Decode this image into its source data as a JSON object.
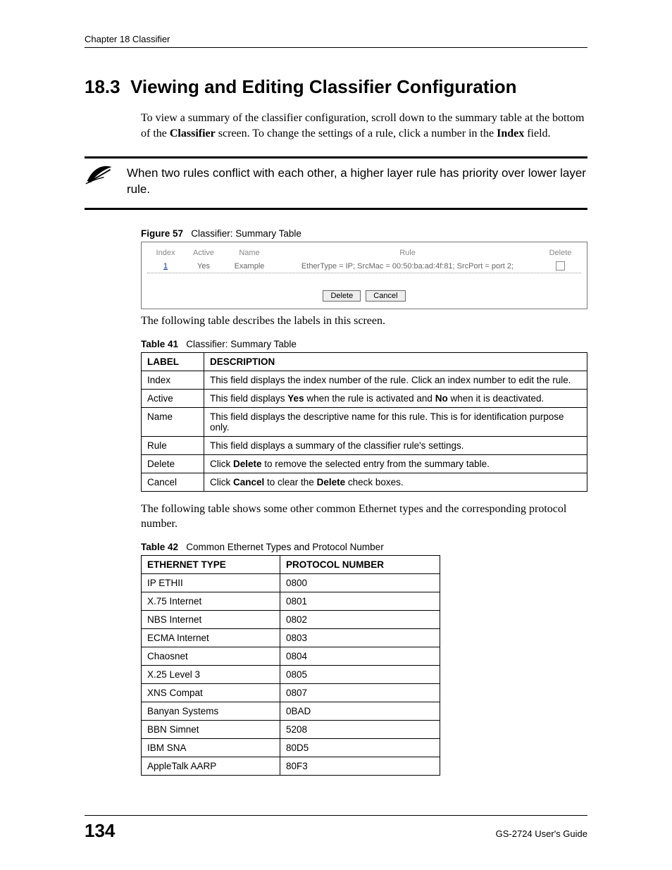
{
  "header": {
    "running": "Chapter 18 Classifier"
  },
  "section": {
    "number": "18.3",
    "title": "Viewing and Editing Classifier Configuration",
    "intro_part1": "To view a summary of the classifier configuration, scroll down to the summary table at the bottom of the ",
    "intro_bold1": "Classifier",
    "intro_part2": " screen. To change the settings of a rule, click a number in the ",
    "intro_bold2": "Index",
    "intro_part3": " field."
  },
  "note": {
    "text": "When two rules conflict with each other, a higher layer rule has priority over lower layer rule."
  },
  "figure57": {
    "label": "Figure 57",
    "title": "Classifier: Summary Table",
    "columns": {
      "index": "Index",
      "active": "Active",
      "name": "Name",
      "rule": "Rule",
      "delete": "Delete"
    },
    "row": {
      "index": "1",
      "active": "Yes",
      "name": "Example",
      "rule": "EtherType = IP; SrcMac = 00:50:ba:ad:4f:81; SrcPort = port 2;"
    },
    "buttons": {
      "delete": "Delete",
      "cancel": "Cancel"
    }
  },
  "after_fig_text": "The following table describes the labels in this screen.",
  "table41": {
    "label": "Table 41",
    "title": "Classifier: Summary Table",
    "headers": {
      "label": "LABEL",
      "description": "DESCRIPTION"
    },
    "rows": [
      {
        "label": "Index",
        "desc_pre": "This field displays the index number of the rule. Click an index number to edit the rule.",
        "b1": "",
        "mid": "",
        "b2": "",
        "post": ""
      },
      {
        "label": "Active",
        "desc_pre": "This field displays ",
        "b1": "Yes",
        "mid": " when the rule is activated and ",
        "b2": "No",
        "post": " when it is deactivated."
      },
      {
        "label": "Name",
        "desc_pre": "This field displays the descriptive name for this rule. This is for identification purpose only.",
        "b1": "",
        "mid": "",
        "b2": "",
        "post": ""
      },
      {
        "label": "Rule",
        "desc_pre": "This field displays a summary of the classifier rule's settings.",
        "b1": "",
        "mid": "",
        "b2": "",
        "post": ""
      },
      {
        "label": "Delete",
        "desc_pre": "Click ",
        "b1": "Delete",
        "mid": " to remove the selected entry from the summary table.",
        "b2": "",
        "post": ""
      },
      {
        "label": "Cancel",
        "desc_pre": "Click ",
        "b1": "Cancel",
        "mid": " to clear the ",
        "b2": "Delete",
        "post": " check boxes."
      }
    ]
  },
  "between_tables_text": "The following table shows some other common Ethernet types and the corresponding protocol number.",
  "table42": {
    "label": "Table 42",
    "title": "Common Ethernet Types and Protocol Number",
    "headers": {
      "type": "ETHERNET TYPE",
      "proto": "PROTOCOL NUMBER"
    },
    "rows": [
      {
        "type": "IP ETHII",
        "proto": "0800"
      },
      {
        "type": "X.75 Internet",
        "proto": "0801"
      },
      {
        "type": "NBS Internet",
        "proto": "0802"
      },
      {
        "type": "ECMA Internet",
        "proto": "0803"
      },
      {
        "type": "Chaosnet",
        "proto": "0804"
      },
      {
        "type": "X.25 Level 3",
        "proto": "0805"
      },
      {
        "type": "XNS Compat",
        "proto": "0807"
      },
      {
        "type": "Banyan Systems",
        "proto": "0BAD"
      },
      {
        "type": "BBN Simnet",
        "proto": "5208"
      },
      {
        "type": "IBM SNA",
        "proto": "80D5"
      },
      {
        "type": "AppleTalk AARP",
        "proto": "80F3"
      }
    ]
  },
  "footer": {
    "page": "134",
    "guide": "GS-2724 User's Guide"
  }
}
